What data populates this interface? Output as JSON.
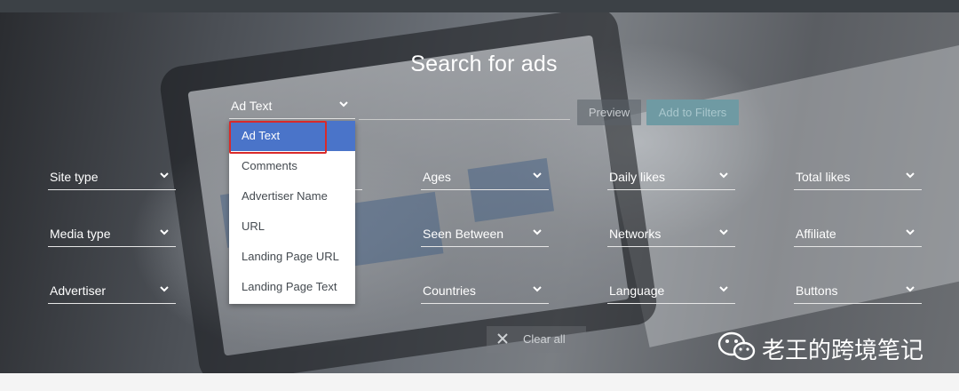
{
  "heading": "Search for ads",
  "search": {
    "type_value": "Ad Text",
    "input_value": "",
    "preview_label": "Preview",
    "add_label": "Add to Filters"
  },
  "dropdown_options": [
    "Ad Text",
    "Comments",
    "Advertiser Name",
    "URL",
    "Landing Page URL",
    "Landing Page Text"
  ],
  "dropdown_selected": "Ad Text",
  "filters": {
    "site_type": "Site type",
    "ages": "Ages",
    "daily_likes": "Daily likes",
    "total_likes": "Total likes",
    "media_type": "Media type",
    "seen_between": "Seen Between",
    "networks": "Networks",
    "affiliate": "Affiliate",
    "advertiser": "Advertiser",
    "countries": "Countries",
    "language": "Language",
    "buttons": "Buttons"
  },
  "clear_all": "Clear all",
  "watermark_text": "老王的跨境笔记",
  "colors": {
    "accent_selected": "#4a74c9",
    "highlight_border": "#d92a2a",
    "add_button": "#6f9aa3"
  },
  "icons": [
    "chevron-down-icon",
    "close-icon",
    "wechat-icon"
  ]
}
